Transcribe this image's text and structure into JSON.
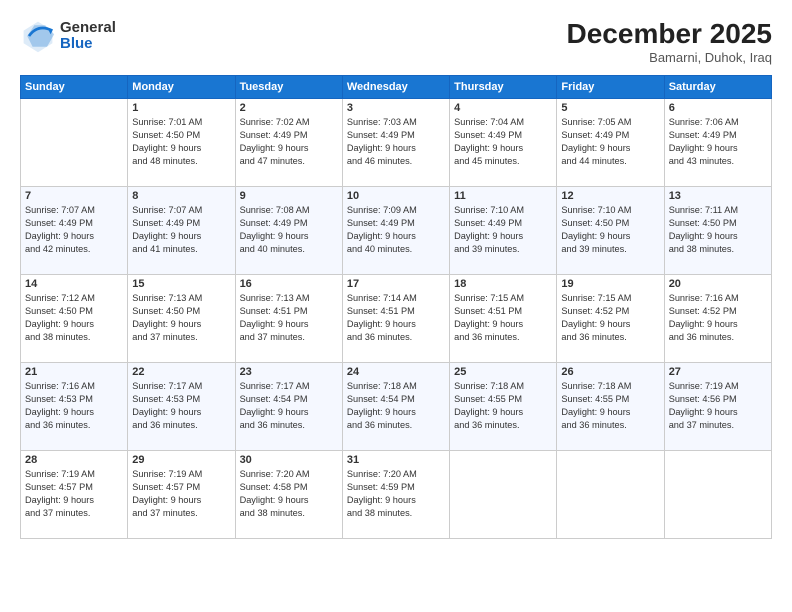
{
  "logo": {
    "general": "General",
    "blue": "Blue"
  },
  "header": {
    "month": "December 2025",
    "location": "Bamarni, Duhok, Iraq"
  },
  "weekdays": [
    "Sunday",
    "Monday",
    "Tuesday",
    "Wednesday",
    "Thursday",
    "Friday",
    "Saturday"
  ],
  "weeks": [
    [
      {
        "day": "",
        "info": ""
      },
      {
        "day": "1",
        "info": "Sunrise: 7:01 AM\nSunset: 4:50 PM\nDaylight: 9 hours\nand 48 minutes."
      },
      {
        "day": "2",
        "info": "Sunrise: 7:02 AM\nSunset: 4:49 PM\nDaylight: 9 hours\nand 47 minutes."
      },
      {
        "day": "3",
        "info": "Sunrise: 7:03 AM\nSunset: 4:49 PM\nDaylight: 9 hours\nand 46 minutes."
      },
      {
        "day": "4",
        "info": "Sunrise: 7:04 AM\nSunset: 4:49 PM\nDaylight: 9 hours\nand 45 minutes."
      },
      {
        "day": "5",
        "info": "Sunrise: 7:05 AM\nSunset: 4:49 PM\nDaylight: 9 hours\nand 44 minutes."
      },
      {
        "day": "6",
        "info": "Sunrise: 7:06 AM\nSunset: 4:49 PM\nDaylight: 9 hours\nand 43 minutes."
      }
    ],
    [
      {
        "day": "7",
        "info": "Sunrise: 7:07 AM\nSunset: 4:49 PM\nDaylight: 9 hours\nand 42 minutes."
      },
      {
        "day": "8",
        "info": "Sunrise: 7:07 AM\nSunset: 4:49 PM\nDaylight: 9 hours\nand 41 minutes."
      },
      {
        "day": "9",
        "info": "Sunrise: 7:08 AM\nSunset: 4:49 PM\nDaylight: 9 hours\nand 40 minutes."
      },
      {
        "day": "10",
        "info": "Sunrise: 7:09 AM\nSunset: 4:49 PM\nDaylight: 9 hours\nand 40 minutes."
      },
      {
        "day": "11",
        "info": "Sunrise: 7:10 AM\nSunset: 4:49 PM\nDaylight: 9 hours\nand 39 minutes."
      },
      {
        "day": "12",
        "info": "Sunrise: 7:10 AM\nSunset: 4:50 PM\nDaylight: 9 hours\nand 39 minutes."
      },
      {
        "day": "13",
        "info": "Sunrise: 7:11 AM\nSunset: 4:50 PM\nDaylight: 9 hours\nand 38 minutes."
      }
    ],
    [
      {
        "day": "14",
        "info": "Sunrise: 7:12 AM\nSunset: 4:50 PM\nDaylight: 9 hours\nand 38 minutes."
      },
      {
        "day": "15",
        "info": "Sunrise: 7:13 AM\nSunset: 4:50 PM\nDaylight: 9 hours\nand 37 minutes."
      },
      {
        "day": "16",
        "info": "Sunrise: 7:13 AM\nSunset: 4:51 PM\nDaylight: 9 hours\nand 37 minutes."
      },
      {
        "day": "17",
        "info": "Sunrise: 7:14 AM\nSunset: 4:51 PM\nDaylight: 9 hours\nand 36 minutes."
      },
      {
        "day": "18",
        "info": "Sunrise: 7:15 AM\nSunset: 4:51 PM\nDaylight: 9 hours\nand 36 minutes."
      },
      {
        "day": "19",
        "info": "Sunrise: 7:15 AM\nSunset: 4:52 PM\nDaylight: 9 hours\nand 36 minutes."
      },
      {
        "day": "20",
        "info": "Sunrise: 7:16 AM\nSunset: 4:52 PM\nDaylight: 9 hours\nand 36 minutes."
      }
    ],
    [
      {
        "day": "21",
        "info": "Sunrise: 7:16 AM\nSunset: 4:53 PM\nDaylight: 9 hours\nand 36 minutes."
      },
      {
        "day": "22",
        "info": "Sunrise: 7:17 AM\nSunset: 4:53 PM\nDaylight: 9 hours\nand 36 minutes."
      },
      {
        "day": "23",
        "info": "Sunrise: 7:17 AM\nSunset: 4:54 PM\nDaylight: 9 hours\nand 36 minutes."
      },
      {
        "day": "24",
        "info": "Sunrise: 7:18 AM\nSunset: 4:54 PM\nDaylight: 9 hours\nand 36 minutes."
      },
      {
        "day": "25",
        "info": "Sunrise: 7:18 AM\nSunset: 4:55 PM\nDaylight: 9 hours\nand 36 minutes."
      },
      {
        "day": "26",
        "info": "Sunrise: 7:18 AM\nSunset: 4:55 PM\nDaylight: 9 hours\nand 36 minutes."
      },
      {
        "day": "27",
        "info": "Sunrise: 7:19 AM\nSunset: 4:56 PM\nDaylight: 9 hours\nand 37 minutes."
      }
    ],
    [
      {
        "day": "28",
        "info": "Sunrise: 7:19 AM\nSunset: 4:57 PM\nDaylight: 9 hours\nand 37 minutes."
      },
      {
        "day": "29",
        "info": "Sunrise: 7:19 AM\nSunset: 4:57 PM\nDaylight: 9 hours\nand 37 minutes."
      },
      {
        "day": "30",
        "info": "Sunrise: 7:20 AM\nSunset: 4:58 PM\nDaylight: 9 hours\nand 38 minutes."
      },
      {
        "day": "31",
        "info": "Sunrise: 7:20 AM\nSunset: 4:59 PM\nDaylight: 9 hours\nand 38 minutes."
      },
      {
        "day": "",
        "info": ""
      },
      {
        "day": "",
        "info": ""
      },
      {
        "day": "",
        "info": ""
      }
    ]
  ]
}
